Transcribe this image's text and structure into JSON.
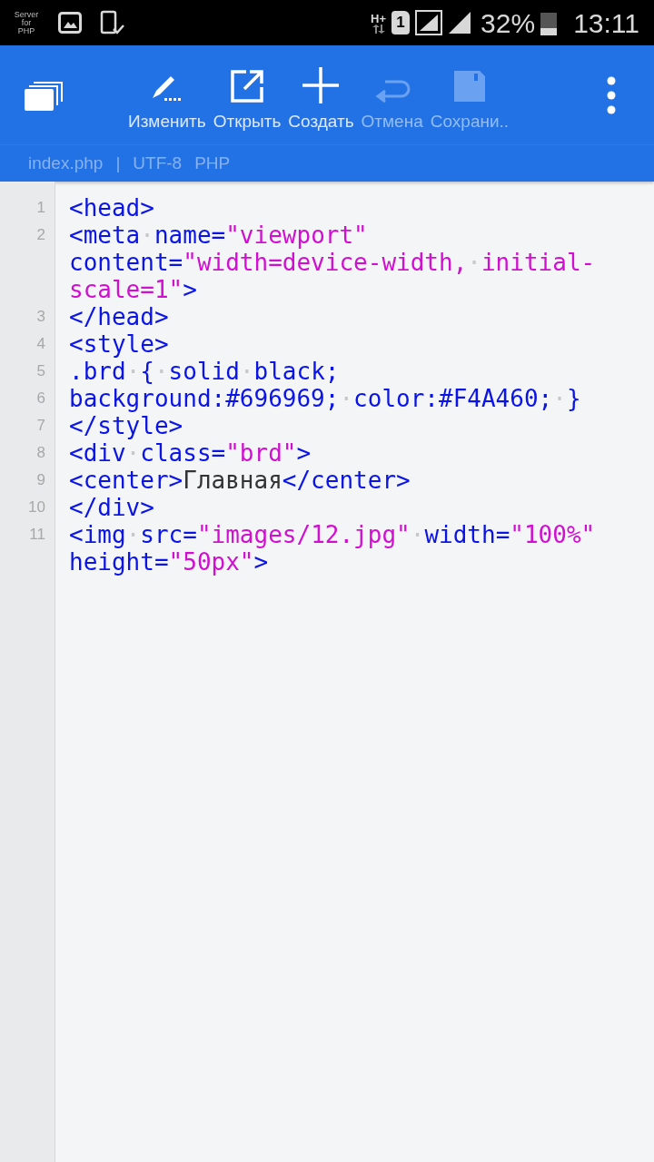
{
  "status_bar": {
    "app_badge": [
      "Server",
      "for",
      "PHP"
    ],
    "network": "H+",
    "sim": "1",
    "battery": "32%",
    "time": "13:11"
  },
  "toolbar": {
    "buttons": [
      {
        "kind": "edit",
        "label": "Изменить",
        "disabled": false
      },
      {
        "kind": "open",
        "label": "Открыть",
        "disabled": false
      },
      {
        "kind": "new",
        "label": "Создать",
        "disabled": false
      },
      {
        "kind": "undo",
        "label": "Отмена",
        "disabled": true
      },
      {
        "kind": "save",
        "label": "Сохрани..",
        "disabled": true
      }
    ]
  },
  "file_bar": {
    "file": "index.php",
    "separator": "|",
    "encoding": "UTF-8",
    "language": "PHP"
  },
  "editor": {
    "lines": [
      {
        "number": "1",
        "rows": [
          {
            "segments": [
              {
                "kind": "tag",
                "text": "<head>"
              }
            ]
          }
        ]
      },
      {
        "number": "2",
        "rows": [
          {
            "segments": [
              {
                "kind": "tag",
                "text": "<meta"
              },
              {
                "kind": "space",
                "text": "·"
              },
              {
                "kind": "tag",
                "text": "name="
              },
              {
                "kind": "string",
                "text": "\"viewport\""
              }
            ]
          },
          {
            "segments": [
              {
                "kind": "tag",
                "text": "content="
              },
              {
                "kind": "string",
                "text": "\"width=device-width,"
              },
              {
                "kind": "space",
                "text": "·"
              },
              {
                "kind": "string",
                "text": "initial-"
              }
            ]
          },
          {
            "segments": [
              {
                "kind": "string",
                "text": "scale=1\""
              },
              {
                "kind": "tag",
                "text": ">"
              }
            ]
          }
        ]
      },
      {
        "number": "3",
        "rows": [
          {
            "segments": [
              {
                "kind": "tag",
                "text": "</head>"
              }
            ]
          }
        ]
      },
      {
        "number": "4",
        "rows": [
          {
            "segments": [
              {
                "kind": "tag",
                "text": "<style>"
              }
            ]
          }
        ]
      },
      {
        "number": "5",
        "rows": [
          {
            "segments": [
              {
                "kind": "tag",
                "text": ".brd"
              },
              {
                "kind": "space",
                "text": "·"
              },
              {
                "kind": "tag",
                "text": "{"
              },
              {
                "kind": "space",
                "text": "·"
              },
              {
                "kind": "tag",
                "text": "solid"
              },
              {
                "kind": "space",
                "text": "·"
              },
              {
                "kind": "tag",
                "text": "black;"
              }
            ]
          }
        ]
      },
      {
        "number": "6",
        "rows": [
          {
            "segments": [
              {
                "kind": "tag",
                "text": "background:#696969;"
              },
              {
                "kind": "space",
                "text": "·"
              },
              {
                "kind": "tag",
                "text": "color:#F4A460;"
              },
              {
                "kind": "space",
                "text": "·"
              },
              {
                "kind": "tag",
                "text": "}"
              }
            ]
          }
        ]
      },
      {
        "number": "7",
        "rows": [
          {
            "segments": [
              {
                "kind": "tag",
                "text": "</style>"
              }
            ]
          }
        ]
      },
      {
        "number": "8",
        "rows": [
          {
            "segments": [
              {
                "kind": "tag",
                "text": "<div"
              },
              {
                "kind": "space",
                "text": "·"
              },
              {
                "kind": "tag",
                "text": "class="
              },
              {
                "kind": "string",
                "text": "\"brd\""
              },
              {
                "kind": "tag",
                "text": ">"
              }
            ]
          }
        ]
      },
      {
        "number": "9",
        "rows": [
          {
            "segments": [
              {
                "kind": "tag",
                "text": "<center>"
              },
              {
                "kind": "text",
                "text": "Главная"
              },
              {
                "kind": "tag",
                "text": "</center>"
              }
            ]
          }
        ]
      },
      {
        "number": "10",
        "rows": [
          {
            "segments": [
              {
                "kind": "tag",
                "text": "</div>"
              }
            ]
          }
        ]
      },
      {
        "number": "11",
        "rows": [
          {
            "segments": [
              {
                "kind": "tag",
                "text": "<img"
              },
              {
                "kind": "space",
                "text": "·"
              },
              {
                "kind": "tag",
                "text": "src="
              },
              {
                "kind": "string",
                "text": "\"images/12.jpg\""
              },
              {
                "kind": "space",
                "text": "·"
              },
              {
                "kind": "tag",
                "text": "width="
              },
              {
                "kind": "string",
                "text": "\"100%\""
              }
            ]
          },
          {
            "segments": [
              {
                "kind": "tag",
                "text": "height="
              },
              {
                "kind": "string",
                "text": "\"50px\""
              },
              {
                "kind": "tag",
                "text": ">"
              }
            ]
          }
        ]
      }
    ]
  }
}
